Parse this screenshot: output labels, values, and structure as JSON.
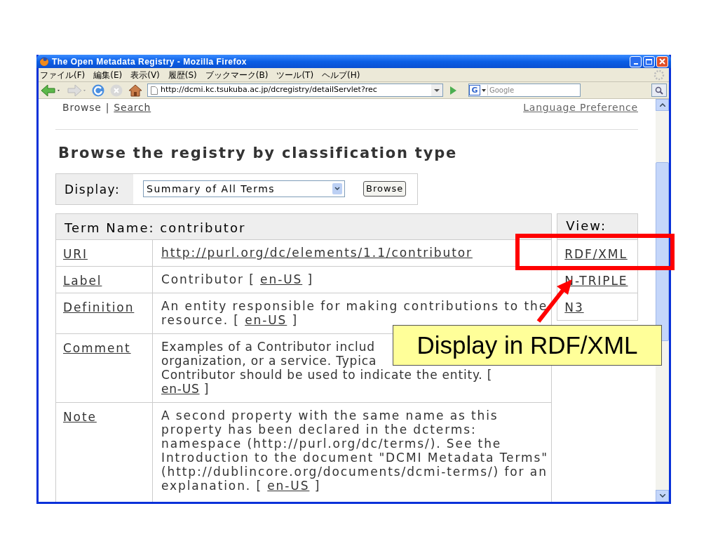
{
  "window": {
    "title": "The Open Metadata Registry - Mozilla Firefox"
  },
  "menu": [
    "ファイル(F)",
    "編集(E)",
    "表示(V)",
    "履歴(S)",
    "ブックマーク(B)",
    "ツール(T)",
    "ヘルプ(H)"
  ],
  "toolbar": {
    "address": "http://dcmi.kc.tsukuba.ac.jp/dcregistry/detailServlet?rec",
    "search_placeholder": "Google",
    "engine_icon": "G"
  },
  "page": {
    "nav": {
      "current": "Browse",
      "separator": "|",
      "link": "Search"
    },
    "language_link": "Language Preference",
    "heading": "Browse the registry by classification type",
    "display": {
      "label": "Display:",
      "value": "Summary of All Terms",
      "button": "Browse"
    },
    "term_table": {
      "header": "Term Name: contributor",
      "rows": [
        {
          "kind": "link",
          "name": "URI",
          "value": "http://purl.org/dc/elements/1.1/contributor"
        },
        {
          "kind": "text",
          "name": "Label",
          "text": "Contributor [",
          "lang": "en-US",
          "end": "]"
        },
        {
          "kind": "text",
          "name": "Definition",
          "text": "An entity responsible for making contributions to the resource. [",
          "lang": "en-US",
          "end": "]"
        },
        {
          "kind": "lines",
          "name": "Comment",
          "lines": [
            "Examples of a Contributor includ",
            "organization, or a service. Typica",
            "Contributor should be used to indicate the entity. ["
          ],
          "lang": "en-US",
          "end": "]"
        },
        {
          "kind": "text",
          "name": "Note",
          "text": "A second property with the same name as this property has been declared in the dcterms: namespace (http://purl.org/dc/terms/). See the Introduction to the document \"DCMI Metadata Terms\" (http://dublincore.org/documents/dcmi-terms/) for an explanation. [",
          "lang": "en-US",
          "end": "]"
        }
      ]
    },
    "view": {
      "header": "View:",
      "links": [
        "RDF/XML",
        "N-TRIPLE",
        "N3"
      ]
    }
  },
  "annotation": {
    "callout": "Display in RDF/XML"
  }
}
